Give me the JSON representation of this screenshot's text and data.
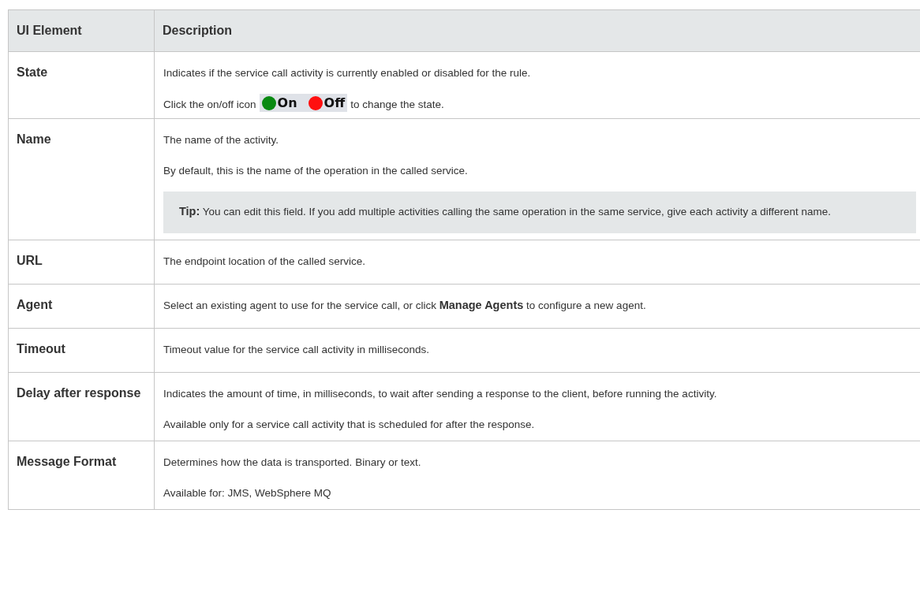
{
  "table": {
    "columns": [
      "UI Element",
      "Description"
    ],
    "rows": [
      {
        "element": "State",
        "paragraphs": [
          {
            "kind": "text",
            "text": "Indicates if the service call activity is currently enabled or disabled for the rule."
          },
          {
            "kind": "icon_text",
            "before": "Click the on/off icon",
            "on_label": "On",
            "off_label": "Off",
            "after": "to change the state."
          }
        ]
      },
      {
        "element": "Name",
        "paragraphs": [
          {
            "kind": "text",
            "text": "The name of the activity."
          },
          {
            "kind": "text",
            "text": "By default, this is the name of the operation in the called service."
          },
          {
            "kind": "tip",
            "label": "Tip:",
            "text": "You can edit this field. If you add multiple activities calling the same operation in the same service, give each activity a different name."
          }
        ]
      },
      {
        "element": "URL",
        "paragraphs": [
          {
            "kind": "text",
            "text": "The endpoint location of the called service."
          }
        ]
      },
      {
        "element": "Agent",
        "paragraphs": [
          {
            "kind": "text",
            "text": "Select an existing agent to use for the service call, or click **Manage Agents** to configure a new agent."
          }
        ]
      },
      {
        "element": "Timeout",
        "paragraphs": [
          {
            "kind": "text",
            "text": "Timeout value for the service call activity in milliseconds."
          }
        ]
      },
      {
        "element": "Delay after response",
        "paragraphs": [
          {
            "kind": "text",
            "text": "Indicates the amount of time, in milliseconds, to wait after sending a response to the client, before running the activity."
          },
          {
            "kind": "text",
            "text": "Available only for a service call activity that is scheduled for after the response."
          }
        ]
      },
      {
        "element": "Message Format",
        "paragraphs": [
          {
            "kind": "text",
            "text": "Determines how the data is transported. Binary or text."
          },
          {
            "kind": "text",
            "text": "Available for: JMS, WebSphere MQ"
          }
        ]
      }
    ]
  }
}
